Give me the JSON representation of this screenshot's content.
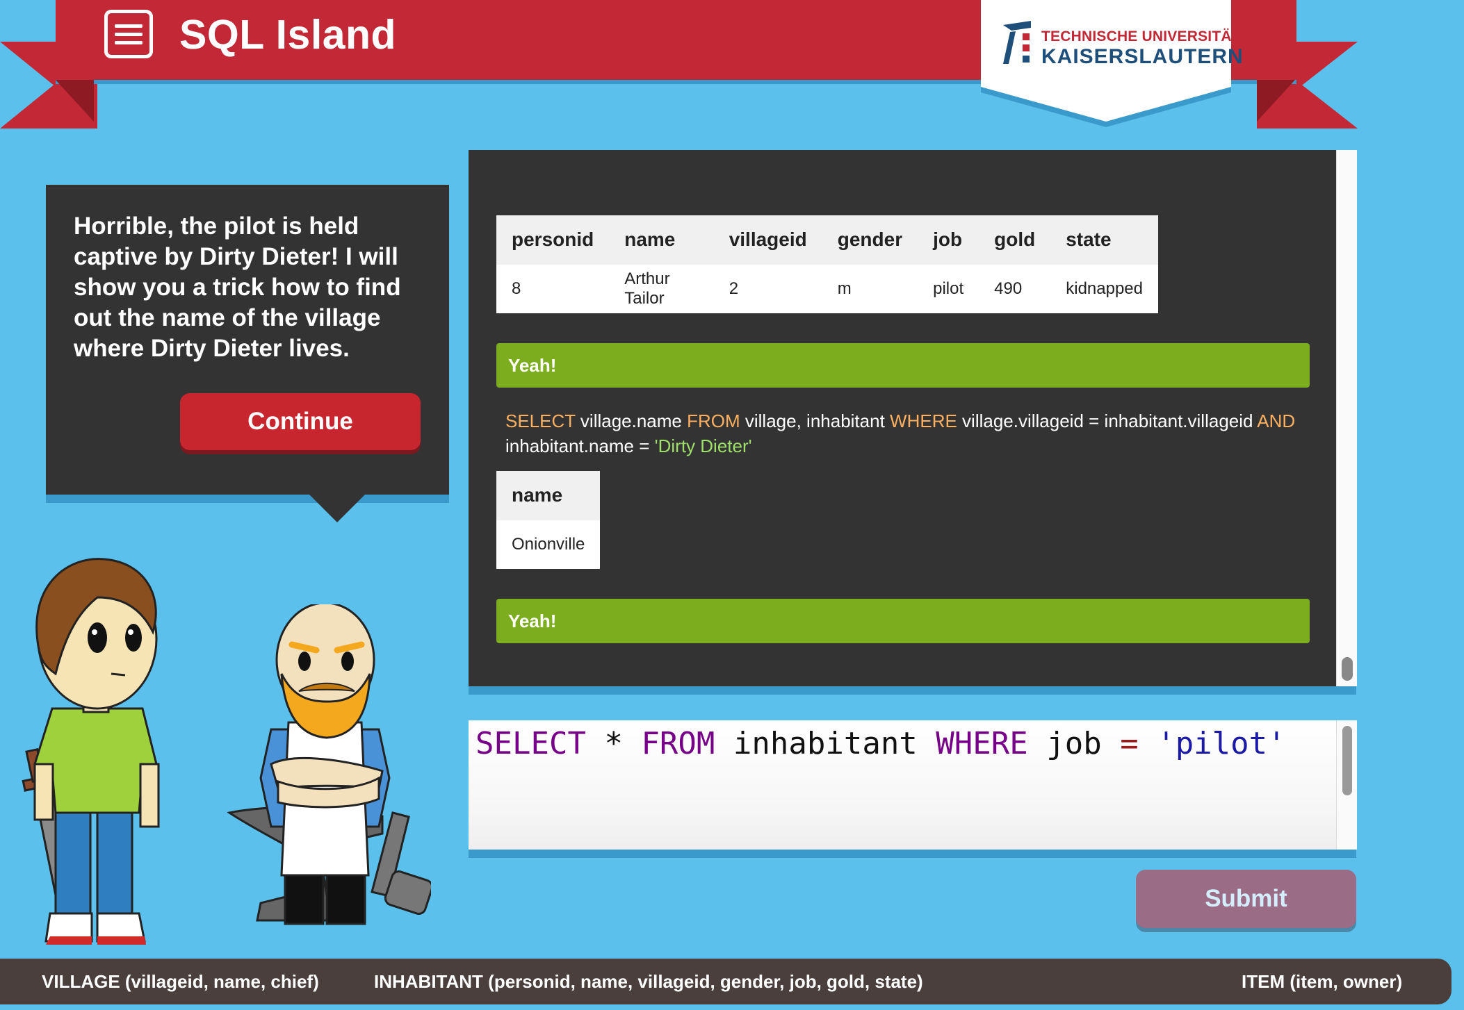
{
  "app": {
    "title": "SQL Island"
  },
  "university": {
    "line1": "TECHNISCHE UNIVERSITÄT",
    "line2": "KAISERSLAUTERN"
  },
  "dialog": {
    "text": "Horrible, the pilot is held captive by Dirty Dieter! I will show you a trick how to find out the name of the village where Dirty Dieter lives.",
    "continue_label": "Continue"
  },
  "results": {
    "table1": {
      "columns": [
        "personid",
        "name",
        "villageid",
        "gender",
        "job",
        "gold",
        "state"
      ],
      "rows": [
        [
          "8",
          "Arthur Tailor",
          "2",
          "m",
          "pilot",
          "490",
          "kidnapped"
        ]
      ]
    },
    "success1": "Yeah!",
    "query2": {
      "kw1": "SELECT",
      "t1": " village.name ",
      "kw2": "FROM",
      "t2": " village, inhabitant ",
      "kw3": "WHERE",
      "t3": " village.villageid = inhabitant.villageid ",
      "kw4": "AND",
      "t4": " inhabitant.name = ",
      "str": "'Dirty Dieter'"
    },
    "table2": {
      "columns": [
        "name"
      ],
      "rows": [
        [
          "Onionville"
        ]
      ]
    },
    "success2": "Yeah!"
  },
  "editor": {
    "kw_select": "SELECT",
    "star": " * ",
    "kw_from": "FROM",
    "table": " inhabitant ",
    "kw_where": "WHERE",
    "col": " job ",
    "op": "=",
    "space": " ",
    "str": "'pilot'"
  },
  "submit_label": "Submit",
  "schema": {
    "village": "VILLAGE (villageid, name, chief)",
    "inhabitant": "INHABITANT (personid, name, villageid, gender, job, gold, state)",
    "item": "ITEM (item, owner)"
  },
  "colors": {
    "background": "#5bc0eb",
    "ribbon": "#c22835",
    "panel": "#333333",
    "success": "#7cad1f",
    "keyword": "#ffb060",
    "string": "#9ee06a",
    "submit": "#9b6c85"
  }
}
